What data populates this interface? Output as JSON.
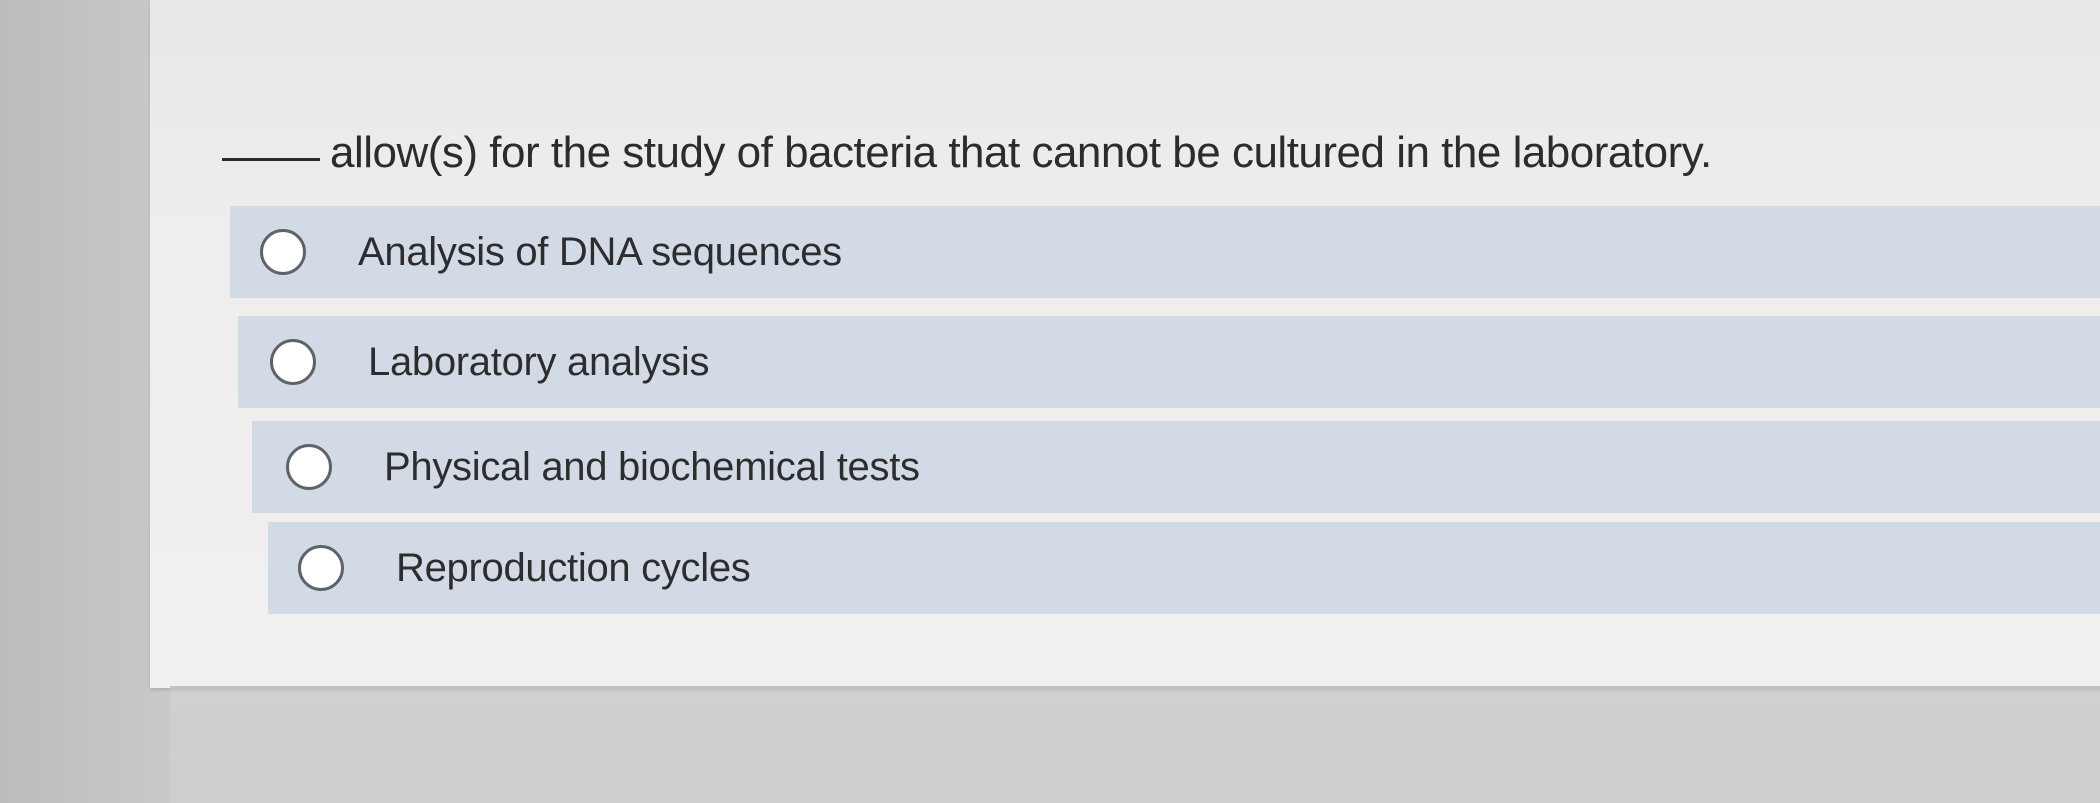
{
  "question": {
    "text": "allow(s) for the study of bacteria that cannot be cultured in the laboratory."
  },
  "options": [
    {
      "label": "Analysis of DNA sequences",
      "selected": false
    },
    {
      "label": "Laboratory analysis",
      "selected": false
    },
    {
      "label": "Physical and biochemical tests",
      "selected": false
    },
    {
      "label": "Reproduction cycles",
      "selected": false
    }
  ],
  "colors": {
    "option_background": "#d2dbe5",
    "card_background": "#f1f0ee",
    "text": "#2c2c2c"
  }
}
